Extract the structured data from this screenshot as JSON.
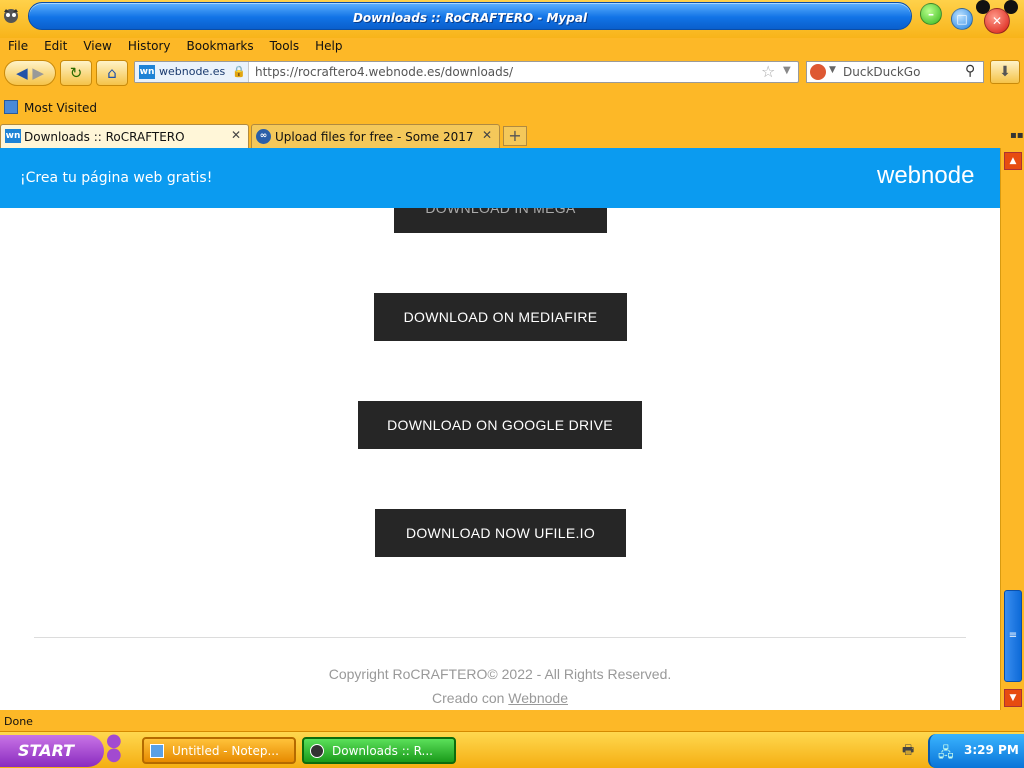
{
  "window": {
    "title": "Downloads :: RoCRAFTERO - Mypal"
  },
  "menu": [
    "File",
    "Edit",
    "View",
    "History",
    "Bookmarks",
    "Tools",
    "Help"
  ],
  "nav": {
    "site_name": "webnode.es",
    "url": "https://rocraftero4.webnode.es/downloads/",
    "search_engine": "DuckDuckGo"
  },
  "bookmarks": {
    "most_visited": "Most Visited"
  },
  "tabs": [
    {
      "label": "Downloads :: RoCRAFTERO",
      "active": true
    },
    {
      "label": "Upload files for free - Some 2017 ...",
      "active": false
    }
  ],
  "page": {
    "banner_link": "¡Crea tu página web gratis!",
    "banner_logo": "webnode",
    "buttons": {
      "mega": "DOWNLOAD IN MEGA",
      "mediafire": "DOWNLOAD ON MEDIAFIRE",
      "gdrive": "DOWNLOAD ON GOOGLE DRIVE",
      "ufile": "DOWNLOAD NOW UFILE.IO"
    },
    "copyright": "Copyright RoCRAFTERO© 2022 - All Rights Reserved.",
    "creado_prefix": "Creado con ",
    "creado_link": "Webnode"
  },
  "status": "Done",
  "taskbar": {
    "start": "START",
    "tasks": [
      "Untitled - Notep...",
      "Downloads :: R..."
    ],
    "clock": "3:29 PM"
  },
  "colors": {
    "banner": "#0b9bf0",
    "button": "#262626",
    "chrome": "#fdb827"
  }
}
